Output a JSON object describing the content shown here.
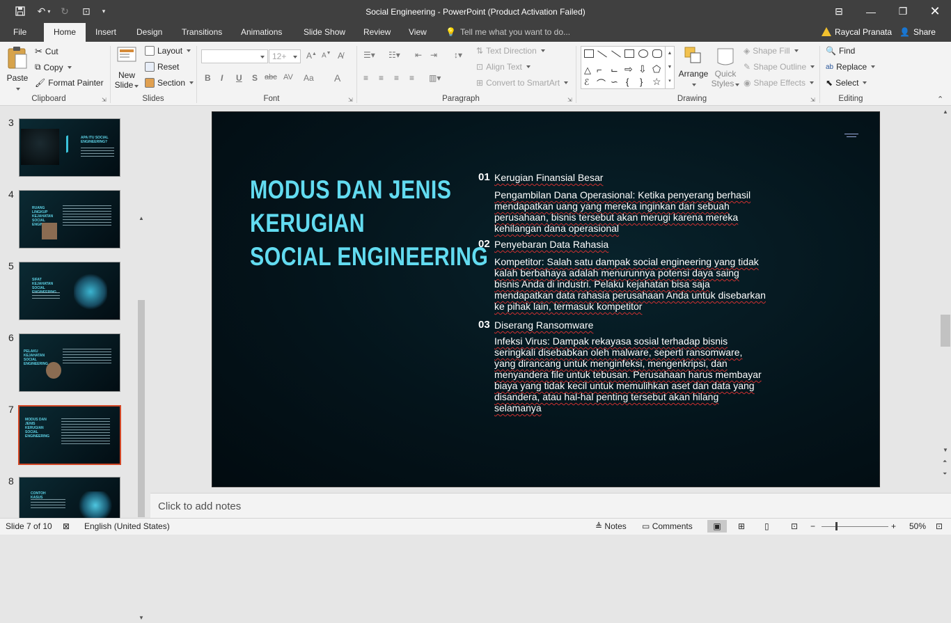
{
  "window": {
    "title": "Social Engineering - PowerPoint (Product Activation Failed)"
  },
  "tabs": [
    "File",
    "Home",
    "Insert",
    "Design",
    "Transitions",
    "Animations",
    "Slide Show",
    "Review",
    "View"
  ],
  "tell_me": "Tell me what you want to do...",
  "user": {
    "name": "Raycal Pranata",
    "warning": "!"
  },
  "share_label": "Share",
  "ribbon": {
    "clipboard": {
      "paste": "Paste",
      "cut": "Cut",
      "copy": "Copy",
      "format_painter": "Format Painter",
      "label": "Clipboard"
    },
    "slides": {
      "new_slide_1": "New",
      "new_slide_2": "Slide",
      "layout": "Layout",
      "reset": "Reset",
      "section": "Section",
      "label": "Slides"
    },
    "font": {
      "size": "12+",
      "bold": "B",
      "italic": "I",
      "underline": "U",
      "shadow": "S",
      "strike": "abc",
      "spacing": "AV",
      "case": "Aa",
      "color": "A",
      "label": "Font"
    },
    "paragraph": {
      "text_direction": "Text Direction",
      "align_text": "Align Text",
      "smartart": "Convert to SmartArt",
      "label": "Paragraph"
    },
    "drawing": {
      "arrange": "Arrange",
      "quick_styles_1": "Quick",
      "quick_styles_2": "Styles",
      "shape_fill": "Shape Fill",
      "shape_outline": "Shape Outline",
      "shape_effects": "Shape Effects",
      "label": "Drawing"
    },
    "editing": {
      "find": "Find",
      "replace": "Replace",
      "select": "Select",
      "label": "Editing"
    }
  },
  "thumbnails": [
    {
      "num": "3",
      "title": "APA ITU SOCIAL ENGINEERING?"
    },
    {
      "num": "4",
      "title": "RUANG LINGKUP KEJAHATAN SOCIAL ENGINEERING"
    },
    {
      "num": "5",
      "title": "SIFAT KEJAHATAN SOCIAL ENGINEERING"
    },
    {
      "num": "6",
      "title": "PELAKU KEJAHATAN SOCIAL ENGINEERING"
    },
    {
      "num": "7",
      "title": "MODUS DAN JENIS KERUGIAN SOCIAL ENGINEERING"
    },
    {
      "num": "8",
      "title": "CONTOH KASUS"
    }
  ],
  "slide": {
    "title_lines": [
      "MODUS DAN JENIS",
      "KERUGIAN",
      "SOCIAL ENGINEERING"
    ],
    "items": [
      {
        "num": "01",
        "head": "Kerugian Finansial Besar",
        "body": "Pengambilan Dana Operasional: Ketika penyerang berhasil mendapatkan uang yang mereka inginkan dari sebuah perusahaan, bisnis tersebut akan merugi karena mereka kehilangan dana operasional"
      },
      {
        "num": "02",
        "head": "Penyebaran Data Rahasia",
        "body": "Kompetitor: Salah satu dampak social engineering yang tidak kalah berbahaya adalah menurunnya potensi daya saing bisnis Anda di industri. Pelaku kejahatan bisa saja mendapatkan data rahasia perusahaan Anda untuk disebarkan ke pihak lain, termasuk kompetitor"
      },
      {
        "num": "03",
        "head": "Diserang Ransomware",
        "body": "Infeksi Virus: Dampak rekayasa sosial terhadap bisnis seringkali disebabkan oleh malware, seperti ransomware, yang dirancang untuk menginfeksi, mengenkripsi, dan menyandera file untuk tebusan. Perusahaan harus membayar biaya yang tidak kecil untuk memulihkan aset dan data yang disandera, atau hal-hal penting tersebut akan hilang selamanya"
      }
    ]
  },
  "notes_placeholder": "Click to add notes",
  "status": {
    "slide": "Slide 7 of 10",
    "language": "English (United States)",
    "notes": "Notes",
    "comments": "Comments",
    "zoom": "50%"
  }
}
